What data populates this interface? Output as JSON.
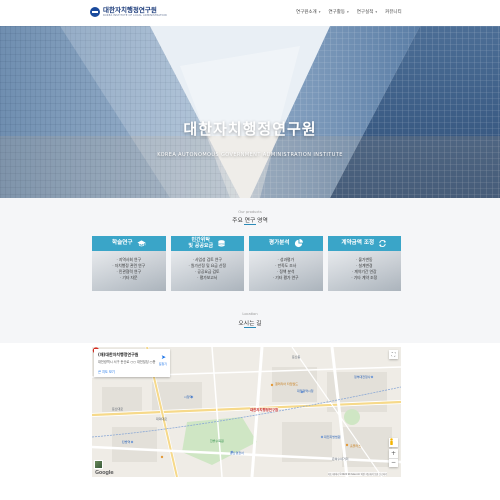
{
  "header": {
    "logo_kr": "대한자치행정연구원",
    "logo_en": "KOREA INSTITUTE OF LOCAL ADMINISTRATION",
    "nav": [
      {
        "label": "연구원소개",
        "has_caret": true
      },
      {
        "label": "연구활동",
        "has_caret": true
      },
      {
        "label": "연구실적",
        "has_caret": true
      },
      {
        "label": "커뮤니티",
        "has_caret": false
      }
    ],
    "caret": "▾"
  },
  "hero": {
    "title": "대한자치행정연구원",
    "subtitle": "KOREA AUTONOMOUS GOVERNMENT ADMINISTRATION INSTITUTE"
  },
  "research": {
    "eyebrow": "Our products",
    "title": "주요 연구 영역",
    "cards": [
      {
        "title": "학술연구",
        "icon": "graduation-cap-icon",
        "items": [
          "· 지역사회 연구",
          "· 자치행정 관련 연구",
          "· 민관협력 연구",
          "· 기타 자문"
        ]
      },
      {
        "title": "민간위탁\n및 공공요금",
        "icon": "coin-stack-icon",
        "items": [
          "· 사업성 검토 연구",
          "· 원가산정 및 요금 산정",
          "· 공공요금 검토",
          "· 평가보고서"
        ]
      },
      {
        "title": "평가분석",
        "icon": "pie-chart-icon",
        "items": [
          "· 성과평가",
          "· 만족도 조사",
          "· 정책 분석",
          "· 기타 평가 연구"
        ]
      },
      {
        "title": "계약금액 조정",
        "icon": "refresh-icon",
        "items": [
          "· 물가변동",
          "· 설계변경",
          "· 계약기간 연장",
          "· 기타 계약 조정"
        ]
      }
    ]
  },
  "location": {
    "eyebrow": "Location",
    "title": "오시는 길"
  },
  "map": {
    "place_name": "(재)대한자치행정연구원",
    "place_addr": "대전광역시 서구 둔산로 ○○ 대전빌딩 ○층",
    "place_link": "큰 지도 보기",
    "directions_label": "길찾기",
    "marker_label": "대한자치행정연구원",
    "google": "Google",
    "attribution": "지도 데이터 ©2024 SK telecom  약관  지도에서 오류 신고하기",
    "labels": [
      {
        "text": "둔산동",
        "cls": "",
        "name": "map-label-district"
      },
      {
        "text": "대전광역시청",
        "cls": "blue",
        "name": "map-label-city-hall"
      },
      {
        "text": "갤러리아 타임월드",
        "cls": "orange",
        "name": "map-label-mall"
      },
      {
        "text": "대전지방법원",
        "cls": "blue",
        "name": "map-label-court"
      },
      {
        "text": "정부대전청사",
        "cls": "blue",
        "name": "map-label-gov"
      },
      {
        "text": "한밭수목원",
        "cls": "green",
        "name": "map-label-park"
      },
      {
        "text": "탄방역",
        "cls": "blue",
        "name": "map-label-station-1"
      },
      {
        "text": "시청역",
        "cls": "blue",
        "name": "map-label-station-2"
      },
      {
        "text": "둔산경찰서",
        "cls": "blue",
        "name": "map-label-police"
      },
      {
        "text": "홈플러스",
        "cls": "orange",
        "name": "map-label-store"
      },
      {
        "text": "둔산대로",
        "cls": "",
        "name": "map-label-road-1"
      },
      {
        "text": "대덕대로",
        "cls": "",
        "name": "map-label-road-2"
      },
      {
        "text": "은하수네거리",
        "cls": "",
        "name": "map-label-crossroad"
      }
    ]
  },
  "colors": {
    "accent": "#3aa5c8",
    "logo": "#1a3a7a",
    "pin": "#d93025"
  }
}
